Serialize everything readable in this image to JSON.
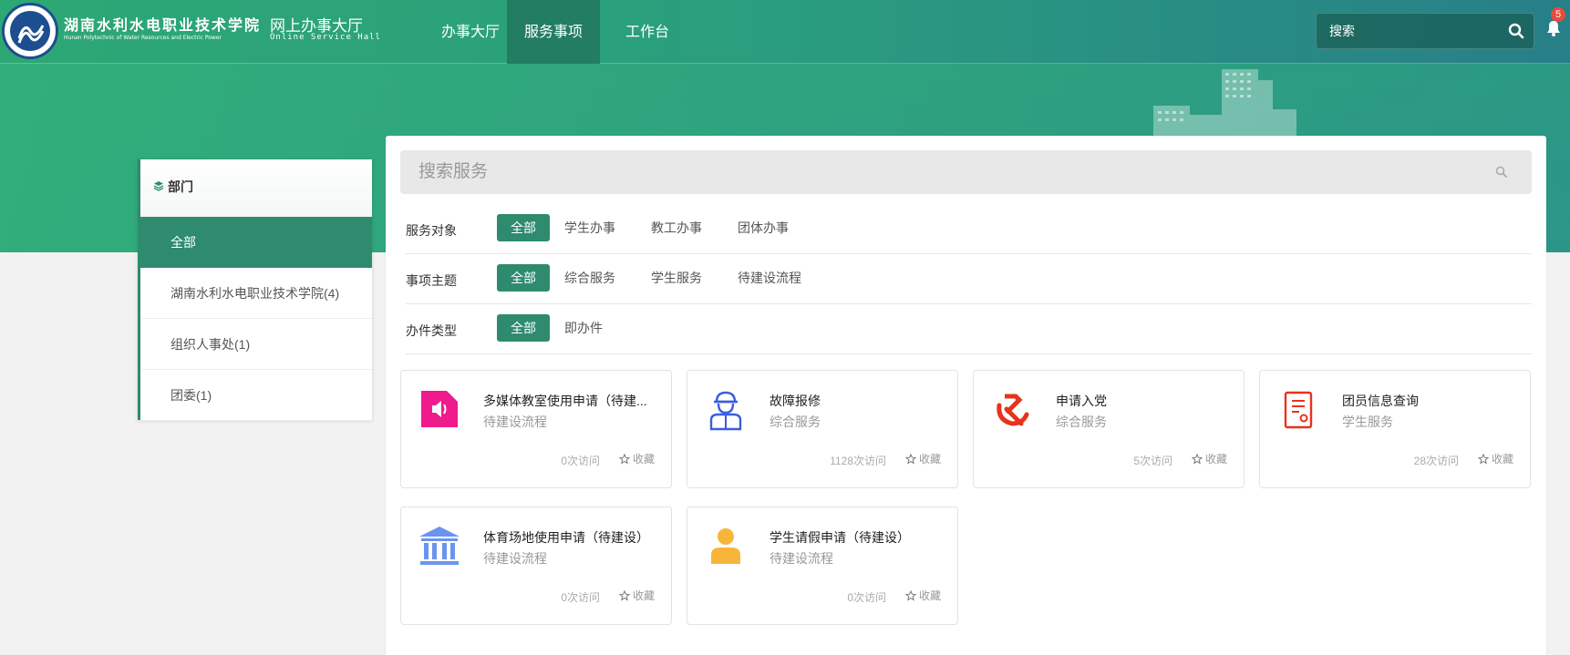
{
  "header": {
    "school_cn": "湖南水利水电职业技术学院",
    "school_en": "Hunan Polytechnic of Water Resources and Electric Power",
    "portal_cn": "网上办事大厅",
    "portal_en": "Online Service Hall",
    "nav": [
      {
        "label": "办事大厅",
        "active": false
      },
      {
        "label": "服务事项",
        "active": true
      },
      {
        "label": "工作台",
        "active": false
      }
    ],
    "search_placeholder": "搜索",
    "notification_count": "5"
  },
  "sidebar": {
    "title": "部门",
    "items": [
      {
        "label": "全部",
        "active": true
      },
      {
        "label": "湖南水利水电职业技术学院(4)",
        "active": false
      },
      {
        "label": "组织人事处(1)",
        "active": false
      },
      {
        "label": "团委(1)",
        "active": false
      }
    ]
  },
  "main": {
    "search_placeholder": "搜索服务",
    "filters": [
      {
        "label": "服务对象",
        "options": [
          "全部",
          "学生办事",
          "教工办事",
          "团体办事"
        ]
      },
      {
        "label": "事项主题",
        "options": [
          "全部",
          "综合服务",
          "学生服务",
          "待建设流程"
        ]
      },
      {
        "label": "办件类型",
        "options": [
          "全部",
          "即办件"
        ]
      }
    ],
    "fav_label": "收藏",
    "cards": [
      {
        "title": "多媒体教室使用申请（待建...",
        "category": "待建设流程",
        "visits": "0次访问",
        "icon": "speaker-icon",
        "color": "#ef1a8b"
      },
      {
        "title": "故障报修",
        "category": "综合服务",
        "visits": "1128次访问",
        "icon": "worker-icon",
        "color": "#3a5ee0"
      },
      {
        "title": "申请入党",
        "category": "综合服务",
        "visits": "5次访问",
        "icon": "party-emblem-icon",
        "color": "#e8331a"
      },
      {
        "title": "团员信息查询",
        "category": "学生服务",
        "visits": "28次访问",
        "icon": "document-icon",
        "color": "#e8331a"
      },
      {
        "title": "体育场地使用申请（待建设）",
        "category": "待建设流程",
        "visits": "0次访问",
        "icon": "building-icon",
        "color": "#6a94ee"
      },
      {
        "title": "学生请假申请（待建设）",
        "category": "待建设流程",
        "visits": "0次访问",
        "icon": "person-icon",
        "color": "#f7b63a"
      }
    ]
  },
  "colors": {
    "primary": "#2e8b6e",
    "banner": "#2faa78"
  }
}
